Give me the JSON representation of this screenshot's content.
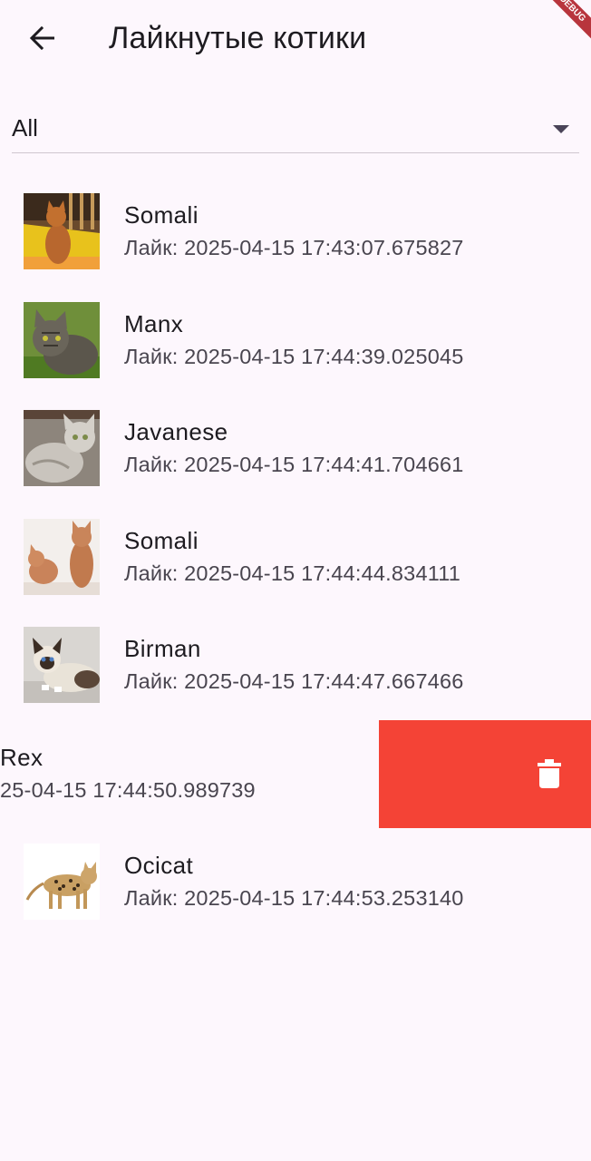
{
  "appbar": {
    "title": "Лайкнутые котики",
    "back_icon": "arrow-left-icon",
    "debug_banner": "DEBUG"
  },
  "filter": {
    "selected": "All",
    "icon": "dropdown-arrow-icon"
  },
  "list": {
    "items": [
      {
        "breed": "Somali",
        "liked": "Лайк: 2025-04-15 17:43:07.675827"
      },
      {
        "breed": "Manx",
        "liked": "Лайк: 2025-04-15 17:44:39.025045"
      },
      {
        "breed": "Javanese",
        "liked": "Лайк: 2025-04-15 17:44:41.704661"
      },
      {
        "breed": "Somali",
        "liked": "Лайк: 2025-04-15 17:44:44.834111"
      },
      {
        "breed": "Birman",
        "liked": "Лайк: 2025-04-15 17:44:47.667466"
      },
      {
        "breed": "Rex",
        "liked": "25-04-15 17:44:50.989739"
      },
      {
        "breed": "Ocicat",
        "liked": "Лайк: 2025-04-15 17:44:53.253140"
      }
    ]
  },
  "swipe_action": {
    "background_color": "#f44336",
    "icon": "trash-icon"
  }
}
